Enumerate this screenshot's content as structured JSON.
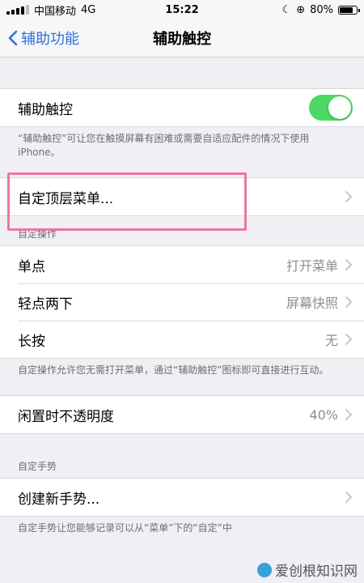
{
  "status_bar": {
    "carrier": "中国移动",
    "network": "4G",
    "time": "15:22",
    "battery": "80%",
    "battery_level": 0.8
  },
  "nav": {
    "back_label": "辅助功能",
    "title": "辅助触控"
  },
  "assistive_touch": {
    "label": "辅助触控",
    "enabled": true,
    "footer": "“辅助触控”可让您在触摸屏幕有困难或需要自适应配件的情况下使用 iPhone。"
  },
  "custom_menu": {
    "label": "自定顶层菜单..."
  },
  "custom_actions": {
    "header": "自定操作",
    "items": [
      {
        "label": "单点",
        "value": "打开菜单"
      },
      {
        "label": "轻点两下",
        "value": "屏幕快照"
      },
      {
        "label": "长按",
        "value": "无"
      }
    ],
    "footer": "自定操作允许您无需打开菜单，通过“辅助触控”图标即可直接进行互动。"
  },
  "idle_opacity": {
    "label": "闲置时不透明度",
    "value": "40%"
  },
  "custom_gestures": {
    "header": "自定手势",
    "create_label": "创建新手势...",
    "footer": "自定手势让您能够记录可以从“菜单”下的“自定”中"
  },
  "watermark": {
    "text": "爱创根知识网"
  },
  "colors": {
    "accent": "#2f6fe0",
    "toggle_on": "#4cd964",
    "highlight": "#e8799e"
  }
}
